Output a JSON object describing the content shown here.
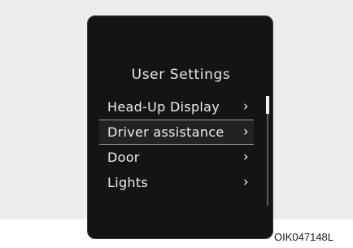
{
  "settings_screen": {
    "title": "User Settings",
    "items": [
      {
        "label": "Head-Up Display",
        "chevron": "›",
        "selected": false
      },
      {
        "label": "Driver assistance",
        "chevron": "›",
        "selected": true
      },
      {
        "label": "Door",
        "chevron": "›",
        "selected": false
      },
      {
        "label": "Lights",
        "chevron": "›",
        "selected": false
      }
    ],
    "scroll_position_fraction": 0.0
  },
  "figure_code": "OIK047148L",
  "colors": {
    "screen_background": "#141414",
    "text": "#ededed",
    "selection_border": "#9a9a9a",
    "page_background": "#ececec"
  }
}
